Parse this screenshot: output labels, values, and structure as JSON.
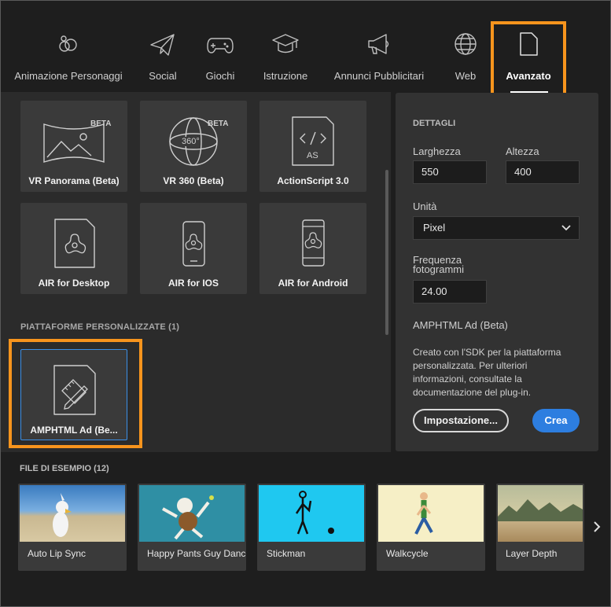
{
  "tabs": [
    {
      "label": "Animazione Personaggi",
      "icon": "characters-icon"
    },
    {
      "label": "Social",
      "icon": "paper-plane-icon"
    },
    {
      "label": "Giochi",
      "icon": "gamepad-icon"
    },
    {
      "label": "Istruzione",
      "icon": "graduation-cap-icon"
    },
    {
      "label": "Annunci Pubblicitari",
      "icon": "megaphone-icon"
    },
    {
      "label": "Web",
      "icon": "globe-icon"
    },
    {
      "label": "Avanzato",
      "icon": "document-icon",
      "active": true
    }
  ],
  "templates": [
    {
      "label": "VR Panorama (Beta)",
      "badge": "BETA",
      "icon": "vr-panorama-icon"
    },
    {
      "label": "VR 360 (Beta)",
      "badge": "BETA",
      "icon": "vr-360-icon",
      "icon_text": "360°"
    },
    {
      "label": "ActionScript 3.0",
      "icon": "actionscript-icon",
      "icon_text": "AS"
    },
    {
      "label": "AIR for Desktop",
      "icon": "air-desktop-icon"
    },
    {
      "label": "AIR for IOS",
      "icon": "air-ios-icon"
    },
    {
      "label": "AIR for Android",
      "icon": "air-android-icon"
    }
  ],
  "custom_platforms": {
    "title": "PIATTAFORME PERSONALIZZATE (1)",
    "items": [
      {
        "label": "AMPHTML Ad (Be...",
        "icon": "ruler-pencil-document-icon"
      }
    ]
  },
  "details": {
    "title": "DETTAGLI",
    "width_label": "Larghezza",
    "width_value": "550",
    "height_label": "Altezza",
    "height_value": "400",
    "unit_label": "Unità",
    "unit_value": "Pixel",
    "fps_label_line1": "Frequenza",
    "fps_label_line2": "fotogrammi",
    "fps_value": "24.00",
    "template_name": "AMPHTML Ad (Beta)",
    "description": "Creato con l'SDK per la piattaforma personalizzata. Per ulteriori informazioni, consultate la documentazione del plug-in.",
    "settings_button": "Impostazione...",
    "create_button": "Crea"
  },
  "samples": {
    "title": "FILE DI ESEMPIO (12)",
    "items": [
      {
        "label": "Auto Lip Sync"
      },
      {
        "label": "Happy Pants Guy Dance"
      },
      {
        "label": "Stickman"
      },
      {
        "label": "Walkcycle"
      },
      {
        "label": "Layer Depth"
      }
    ]
  },
  "colors": {
    "highlight": "#f7941d",
    "accent": "#2d7ee0",
    "selection_border": "#3b8fe6"
  }
}
